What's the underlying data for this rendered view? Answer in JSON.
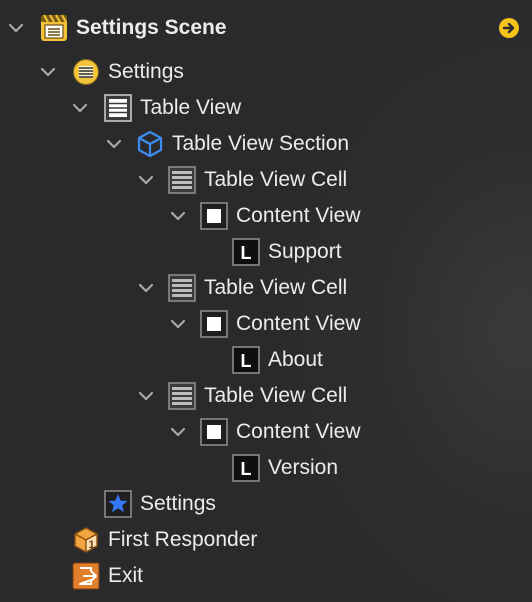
{
  "outline": {
    "scene_title": "Settings Scene",
    "settings_controller": "Settings",
    "table_view": "Table View",
    "table_view_section": "Table View Section",
    "cells": [
      {
        "cell_label": "Table View Cell",
        "content_view_label": "Content View",
        "text_label": "Support"
      },
      {
        "cell_label": "Table View Cell",
        "content_view_label": "Content View",
        "text_label": "About"
      },
      {
        "cell_label": "Table View Cell",
        "content_view_label": "Content View",
        "text_label": "Version"
      }
    ],
    "tab_bar_item": "Settings",
    "first_responder": "First Responder",
    "exit": "Exit",
    "label_icon_letter": "L",
    "first_responder_badge": "1"
  },
  "colors": {
    "accent_yellow": "#f7c31b",
    "scene_icon_yellow": "#f3c33b",
    "cube_blue": "#3b8df0",
    "star_blue": "#3478f6",
    "responder_orange": "#e7922d",
    "exit_orange": "#e27f2b",
    "text": "#ececec",
    "chevron": "#a9a9ab"
  },
  "icons": {
    "scene": "storyboard-scene-icon",
    "controller": "table-view-controller-icon",
    "table_view": "table-view-icon",
    "section": "cube-icon",
    "cell": "table-cell-icon",
    "content_view": "view-icon",
    "label": "label-icon",
    "tab_item": "star-icon",
    "first_responder": "first-responder-cube-icon",
    "exit": "exit-icon",
    "go_to": "go-to-arrow-icon"
  }
}
